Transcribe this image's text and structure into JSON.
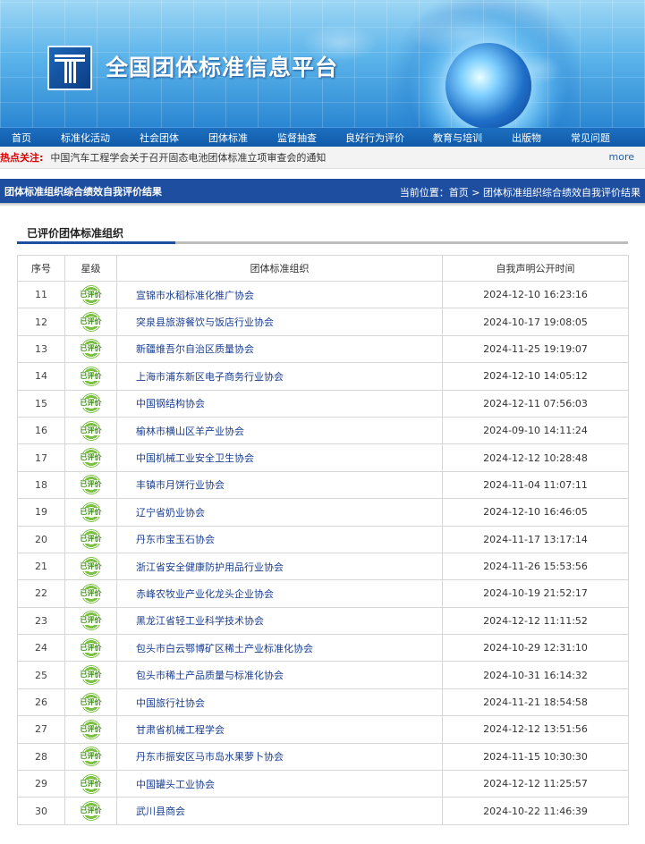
{
  "site": {
    "title": "全国团体标准信息平台"
  },
  "nav": [
    "首页",
    "标准化活动",
    "社会团体",
    "团体标准",
    "监督抽查",
    "良好行为评价",
    "教育与培训",
    "出版物",
    "常见问题"
  ],
  "hotbar": {
    "label": "热点关注:",
    "text": "中国汽车工程学会关于召开固态电池团体标准立项审查会的通知",
    "more": "more"
  },
  "pagebar": {
    "title": "团体标准组织综合绩效自我评价结果",
    "breadcrumb": "当前位置：首页 > 团体标准组织综合绩效自我评价结果"
  },
  "section": {
    "title": "已评价团体标准组织"
  },
  "table": {
    "headers": [
      "序号",
      "星级",
      "团体标准组织",
      "自我声明公开时间"
    ],
    "badge_text": "已评价",
    "rows": [
      {
        "no": "11",
        "org": "宣锦市水稻标准化推广协会",
        "time": "2024-12-10 16:23:16"
      },
      {
        "no": "12",
        "org": "突泉县旅游餐饮与饭店行业协会",
        "time": "2024-10-17 19:08:05"
      },
      {
        "no": "13",
        "org": "新疆维吾尔自治区质量协会",
        "time": "2024-11-25 19:19:07"
      },
      {
        "no": "14",
        "org": "上海市浦东新区电子商务行业协会",
        "time": "2024-12-10 14:05:12"
      },
      {
        "no": "15",
        "org": "中国钢结构协会",
        "time": "2024-12-11 07:56:03"
      },
      {
        "no": "16",
        "org": "榆林市横山区羊产业协会",
        "time": "2024-09-10 14:11:24"
      },
      {
        "no": "17",
        "org": "中国机械工业安全卫生协会",
        "time": "2024-12-12 10:28:48"
      },
      {
        "no": "18",
        "org": "丰镇市月饼行业协会",
        "time": "2024-11-04 11:07:11"
      },
      {
        "no": "19",
        "org": "辽宁省奶业协会",
        "time": "2024-12-10 16:46:05"
      },
      {
        "no": "20",
        "org": "丹东市宝玉石协会",
        "time": "2024-11-17 13:17:14"
      },
      {
        "no": "21",
        "org": "浙江省安全健康防护用品行业协会",
        "time": "2024-11-26 15:53:56"
      },
      {
        "no": "22",
        "org": "赤峰农牧业产业化龙头企业协会",
        "time": "2024-10-19 21:52:17"
      },
      {
        "no": "23",
        "org": "黑龙江省轻工业科学技术协会",
        "time": "2024-12-12 11:11:52"
      },
      {
        "no": "24",
        "org": "包头市白云鄂博矿区稀土产业标准化协会",
        "time": "2024-10-29 12:31:10"
      },
      {
        "no": "25",
        "org": "包头市稀土产品质量与标准化协会",
        "time": "2024-10-31 16:14:32"
      },
      {
        "no": "26",
        "org": "中国旅行社协会",
        "time": "2024-11-21 18:54:58"
      },
      {
        "no": "27",
        "org": "甘肃省机械工程学会",
        "time": "2024-12-12 13:51:56"
      },
      {
        "no": "28",
        "org": "丹东市振安区马市岛水果萝卜协会",
        "time": "2024-11-15 10:30:30"
      },
      {
        "no": "29",
        "org": "中国罐头工业协会",
        "time": "2024-12-12 11:25:57"
      },
      {
        "no": "30",
        "org": "武川县商会",
        "time": "2024-10-22 11:46:39"
      }
    ]
  }
}
